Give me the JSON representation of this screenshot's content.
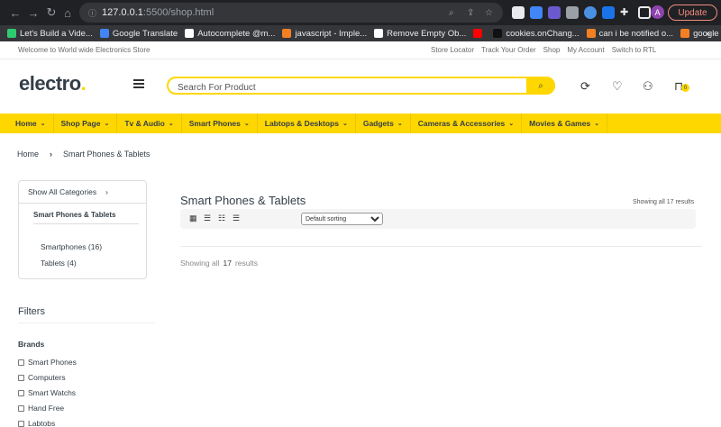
{
  "browser": {
    "url_host": "127.0.0.1",
    "url_path": ":5500/shop.html",
    "update_label": "Update",
    "avatar_letter": "A",
    "bookmarks": [
      {
        "label": "Let's Build a Vide...",
        "color": "#2ecc71"
      },
      {
        "label": "Google Translate",
        "color": "#4285f4"
      },
      {
        "label": "Autocomplete @m...",
        "color": "#ffffff"
      },
      {
        "label": "javascript - Imple...",
        "color": "#f48024"
      },
      {
        "label": "Remove Empty Ob...",
        "color": "#ffffff"
      },
      {
        "label": "",
        "color": "#ff0000"
      },
      {
        "label": "cookies.onChang...",
        "color": "#111111"
      },
      {
        "label": "can i be notified o...",
        "color": "#f48024"
      },
      {
        "label": "google chrome ex...",
        "color": "#f48024"
      }
    ],
    "more_bookmarks": "»"
  },
  "topbar": {
    "welcome": "Welcome to World wide Electronics Store",
    "links": [
      "Store Locator",
      "Track Your Order",
      "Shop",
      "My Account",
      "Switch to RTL"
    ]
  },
  "header": {
    "logo_text": "electro",
    "logo_dot": ".",
    "search_placeholder": "Search For Product",
    "cart_count": "0"
  },
  "nav": {
    "items": [
      "Home",
      "Shop Page",
      "Tv & Audio",
      "Smart Phones",
      "Labtops & Desktops",
      "Gadgets",
      "Cameras & Accessories",
      "Movies & Games"
    ]
  },
  "breadcrumb": {
    "home": "Home",
    "current": "Smart Phones & Tablets"
  },
  "sidebar": {
    "show_all": "Show All Categories",
    "current_category": "Smart Phones & Tablets",
    "subcategories": [
      "Smartphones (16)",
      "Tablets (4)"
    ],
    "filters_title": "Filters",
    "brands_title": "Brands",
    "brands": [
      "Smart Phones",
      "Computers",
      "Smart Watchs",
      "Hand Free",
      "Labtobs"
    ]
  },
  "main": {
    "title": "Smart Phones & Tablets",
    "showing_top": "Showing all 17 results",
    "sort_options": [
      "Default sorting"
    ],
    "showing_prefix": "Showing all",
    "showing_count": "17",
    "showing_suffix": "results"
  },
  "colors": {
    "accent": "#fed700",
    "text": "#333e48"
  }
}
